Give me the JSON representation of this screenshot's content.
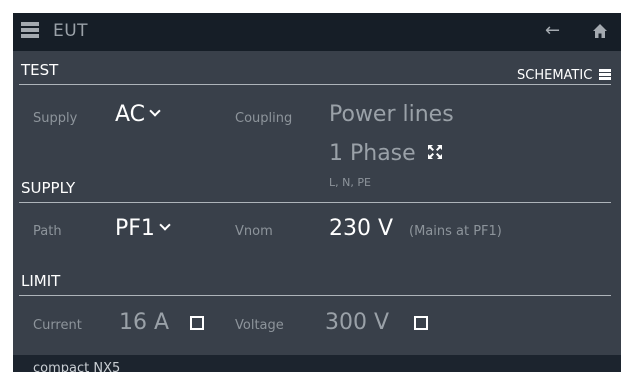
{
  "header": {
    "title": "EUT",
    "menu_icon": "list-icon",
    "back_icon": "arrow-left-icon",
    "home_icon": "home-icon"
  },
  "test": {
    "section_title": "TEST",
    "schematic_label": "SCHEMATIC",
    "supply_label": "Supply",
    "supply_value": "AC",
    "coupling_label": "Coupling",
    "coupling_value": "Power lines",
    "phase_value": "1 Phase",
    "lines_value": "L, N, PE"
  },
  "supply": {
    "section_title": "SUPPLY",
    "path_label": "Path",
    "path_value": "PF1",
    "vnom_label": "Vnom",
    "vnom_value": "230 V",
    "vnom_note": "(Mains at PF1)"
  },
  "limit": {
    "section_title": "LIMIT",
    "current_label": "Current",
    "current_value": "16 A",
    "current_checked": false,
    "voltage_label": "Voltage",
    "voltage_value": "300 V",
    "voltage_checked": false
  },
  "footer": {
    "device": "compact NX5"
  },
  "colors": {
    "background": "#39404a",
    "topbar": "#161e27",
    "label": "#8d949b",
    "value": "#ffffff",
    "disabled": "#9aa1a8"
  }
}
